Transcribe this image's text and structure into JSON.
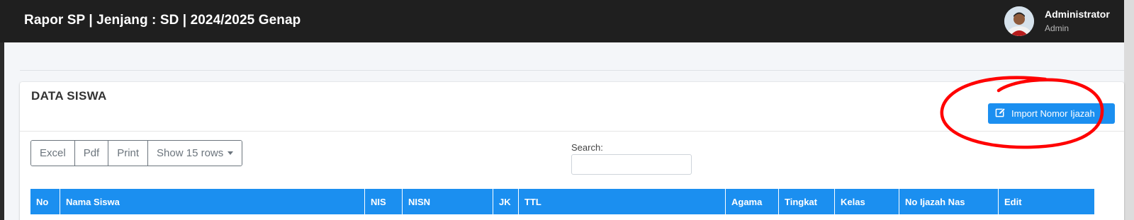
{
  "header": {
    "title": "Rapor SP | Jenjang : SD | 2024/2025 Genap",
    "user_name": "Administrator",
    "user_role": "Admin"
  },
  "card": {
    "title": "DATA SISWA",
    "import_label": "Import Nomor Ijazah"
  },
  "toolbar": {
    "excel": "Excel",
    "pdf": "Pdf",
    "print": "Print",
    "rows": "Show 15 rows"
  },
  "search": {
    "label": "Search:",
    "value": ""
  },
  "table": {
    "columns": [
      "No",
      "Nama Siswa",
      "NIS",
      "NISN",
      "JK",
      "TTL",
      "Agama",
      "Tingkat",
      "Kelas",
      "No Ijazah Nas",
      "Edit"
    ]
  },
  "colors": {
    "topbar": "#1f1f1f",
    "accent": "#1b8ff0",
    "annotation": "#ff0000"
  },
  "icons": {
    "import": "edit-icon",
    "rows_dropdown": "caret-down-icon"
  }
}
